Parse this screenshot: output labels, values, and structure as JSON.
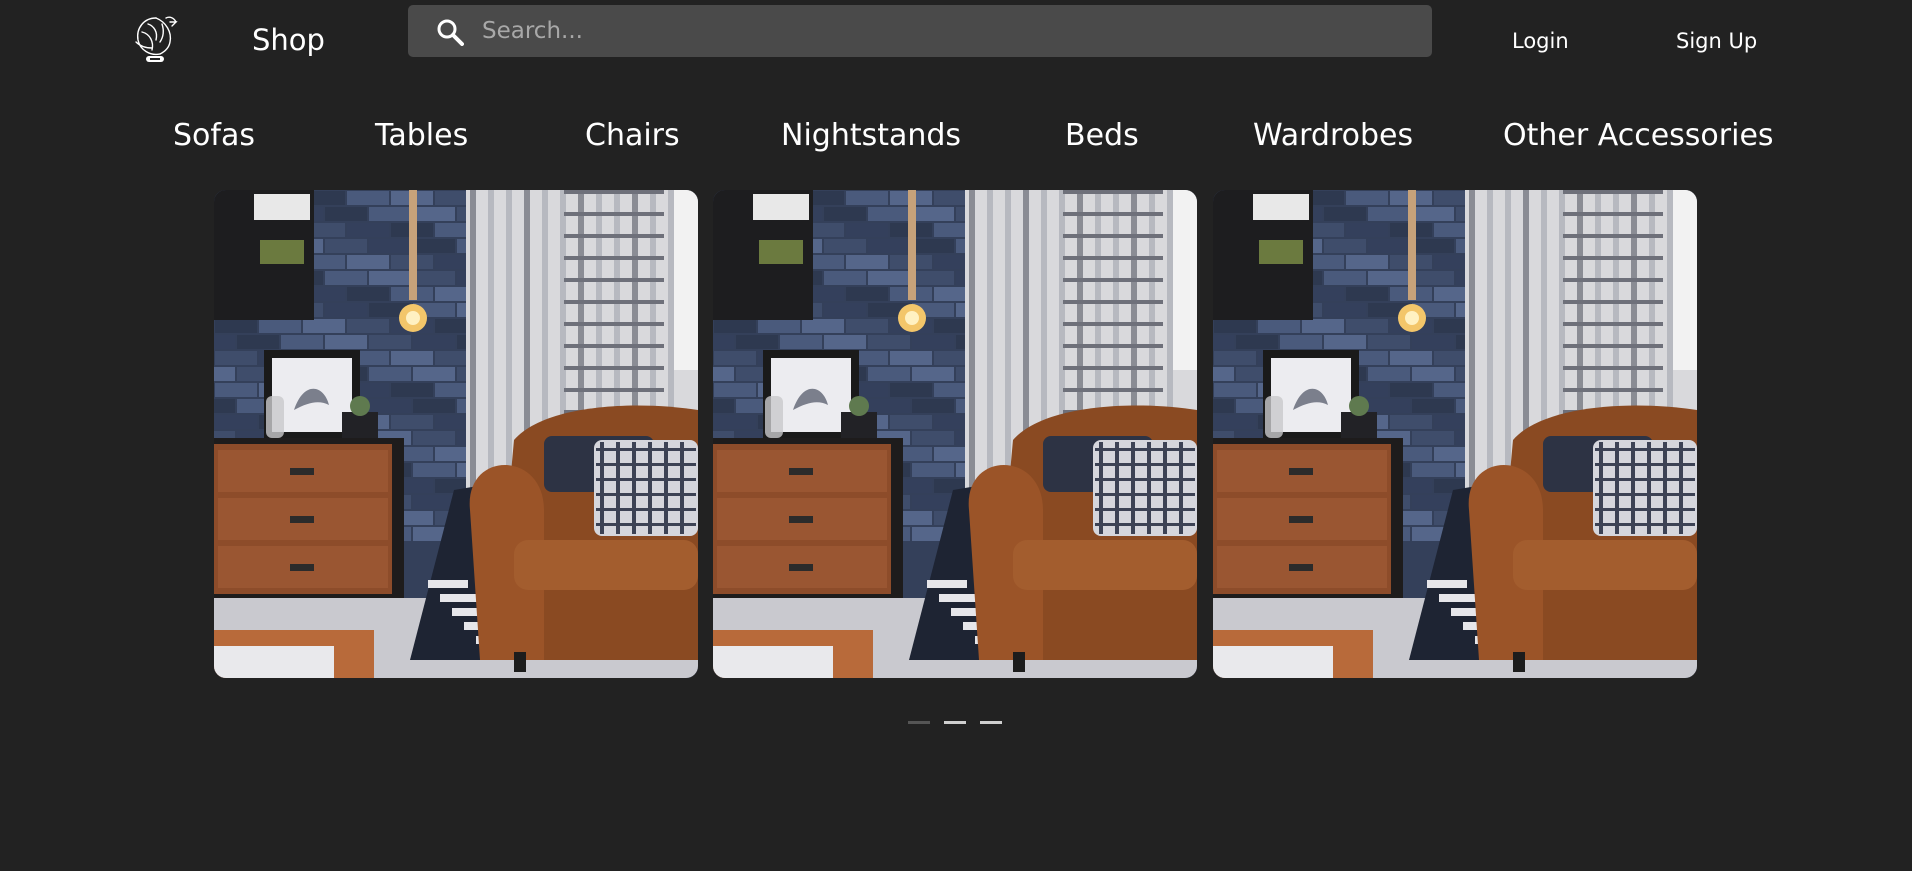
{
  "header": {
    "logo_icon": "bird-logo-icon",
    "shop_label": "Shop",
    "search": {
      "placeholder": "Search...",
      "value": "",
      "icon": "search-icon"
    },
    "login_label": "Login",
    "signup_label": "Sign Up"
  },
  "categories": [
    {
      "label": "Sofas"
    },
    {
      "label": "Tables"
    },
    {
      "label": "Chairs"
    },
    {
      "label": "Nightstands"
    },
    {
      "label": "Beds"
    },
    {
      "label": "Wardrobes"
    },
    {
      "label": "Other Accessories"
    }
  ],
  "carousel": {
    "slides": [
      {
        "image": "living-room-armchair-nightstand-photo"
      },
      {
        "image": "living-room-armchair-nightstand-photo"
      },
      {
        "image": "living-room-armchair-nightstand-photo"
      }
    ],
    "indicators": [
      {
        "active": false
      },
      {
        "active": true
      },
      {
        "active": true
      }
    ]
  },
  "colors": {
    "background": "#222222",
    "search_background": "#4a4a4a",
    "text": "#ffffff",
    "indicator_active": "#cfcfcf",
    "indicator_inactive": "#555555"
  }
}
